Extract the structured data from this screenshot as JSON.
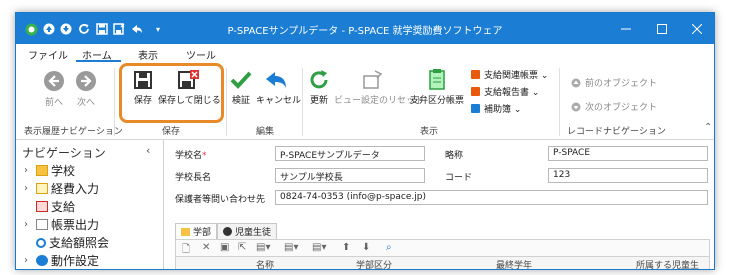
{
  "window": {
    "title": "P-SPACEサンプルデータ - P-SPACE 就学奨励費ソフトウェア",
    "accent_color": "#1b7ed4"
  },
  "quick_access": {
    "icons": [
      "app-logo-icon",
      "up-arrow-icon",
      "down-arrow-icon",
      "refresh-icon",
      "save-icon",
      "save-close-icon",
      "back-icon",
      "dropdown-icon"
    ]
  },
  "menu": {
    "items": [
      "ファイル",
      "ホーム",
      "表示",
      "ツール"
    ],
    "active": "ホーム"
  },
  "ribbon": {
    "history_nav": {
      "back": "前へ",
      "forward": "次へ",
      "group": "表示履歴ナビゲーション"
    },
    "save_group": {
      "save": "保存",
      "save_close": "保存して閉じる",
      "group": "保存"
    },
    "edit_group": {
      "verify": "検証",
      "cancel": "キャンセル",
      "group": "編集"
    },
    "view_group": {
      "refresh": "更新",
      "reset_view": "ビュー設定のリセット",
      "payment_div": "支弁区分帳票",
      "report_menu": "支給関連帳票 ⌄",
      "payment_report": "支給報告書 ⌄",
      "subsidy": "補助簿 ⌄",
      "group": "表示"
    },
    "record_nav": {
      "prev": "前のオブジェクト",
      "next": "次のオブジェクト",
      "group": "レコードナビゲーション"
    }
  },
  "nav": {
    "title": "ナビゲーション",
    "items": [
      {
        "label": "学校",
        "expandable": true
      },
      {
        "label": "経費入力",
        "expandable": true
      },
      {
        "label": "支給",
        "expandable": false
      },
      {
        "label": "帳票出力",
        "expandable": true
      },
      {
        "label": "支給額照会",
        "expandable": false
      },
      {
        "label": "動作設定",
        "expandable": true
      }
    ]
  },
  "form": {
    "school_name_label": "学校名",
    "school_name_required": "*",
    "school_name": "P-SPACEサンプルデータ",
    "abbrev_label": "略称",
    "abbrev": "P-SPACE",
    "principal_label": "学校長名",
    "principal": "サンプル学校長",
    "code_label": "コード",
    "code": "123",
    "contact_label": "保護者等問い合わせ先",
    "contact": "0824-74-0353 (info@p-space.jp)",
    "tabs": [
      "学部",
      "児童生徒"
    ],
    "grid_headers": [
      "名称",
      "学部区分",
      "最終学年",
      "所属する児童生"
    ]
  }
}
